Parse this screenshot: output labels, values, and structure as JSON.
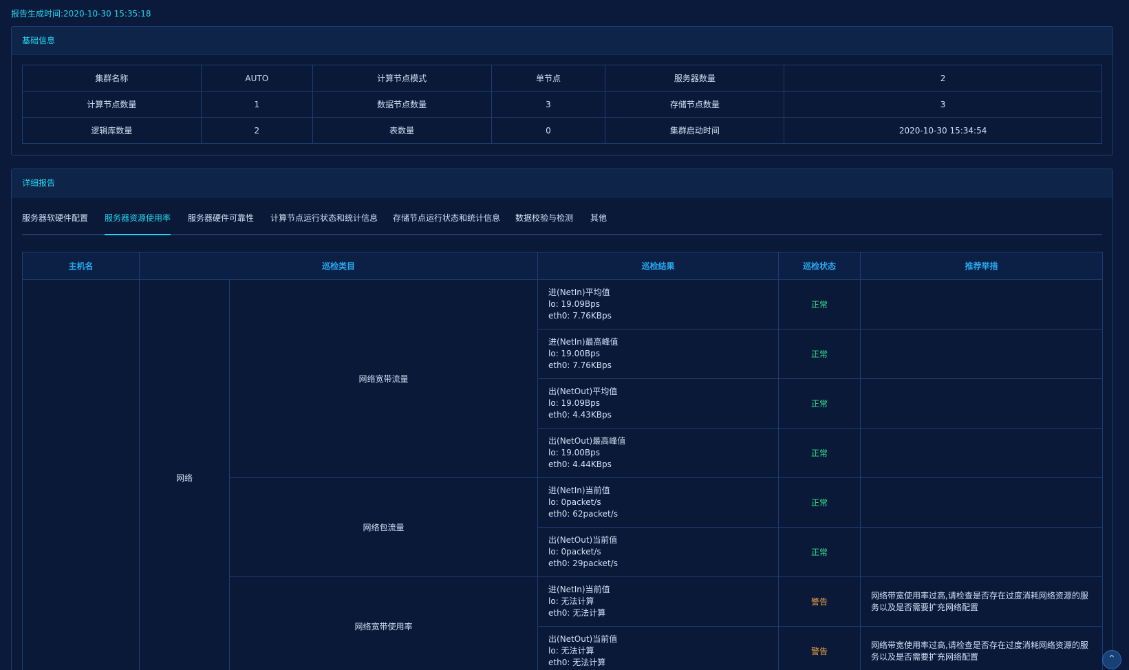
{
  "report": {
    "label": "报告生成时间:",
    "time": "2020-10-30 15:35:18"
  },
  "basic": {
    "title": "基础信息",
    "rows": [
      [
        "集群名称",
        "AUTO",
        "计算节点模式",
        "单节点",
        "服务器数量",
        "2"
      ],
      [
        "计算节点数量",
        "1",
        "数据节点数量",
        "3",
        "存储节点数量",
        "3"
      ],
      [
        "逻辑库数量",
        "2",
        "表数量",
        "0",
        "集群启动时间",
        "2020-10-30 15:34:54"
      ]
    ]
  },
  "detail": {
    "title": "详细报告",
    "tabs": [
      "服务器软硬件配置",
      "服务器资源使用率",
      "服务器硬件可靠性",
      "计算节点运行状态和统计信息",
      "存储节点运行状态和统计信息",
      "数据校验与检测",
      "其他"
    ],
    "active_tab": 1,
    "headers": [
      "主机名",
      "巡检类目",
      "巡检结果",
      "巡检状态",
      "推荐举措"
    ],
    "category": "网络",
    "groups": [
      {
        "name": "网络宽带流量"
      },
      {
        "name": "网络包流量"
      },
      {
        "name": "网络宽带使用率"
      }
    ],
    "rows": [
      {
        "result": [
          "进(NetIn)平均值",
          "lo: 19.09Bps",
          "eth0: 7.76KBps"
        ],
        "status": "正常",
        "advice": ""
      },
      {
        "result": [
          "进(NetIn)最高峰值",
          "lo: 19.00Bps",
          "eth0: 7.76KBps"
        ],
        "status": "正常",
        "advice": ""
      },
      {
        "result": [
          "出(NetOut)平均值",
          "lo: 19.09Bps",
          "eth0: 4.43KBps"
        ],
        "status": "正常",
        "advice": ""
      },
      {
        "result": [
          "出(NetOut)最高峰值",
          "lo: 19.00Bps",
          "eth0: 4.44KBps"
        ],
        "status": "正常",
        "advice": ""
      },
      {
        "result": [
          "进(NetIn)当前值",
          "lo: 0packet/s",
          "eth0: 62packet/s"
        ],
        "status": "正常",
        "advice": ""
      },
      {
        "result": [
          "出(NetOut)当前值",
          "lo: 0packet/s",
          "eth0: 29packet/s"
        ],
        "status": "正常",
        "advice": ""
      },
      {
        "result": [
          "进(NetIn)当前值",
          "lo: 无法计算",
          "eth0: 无法计算"
        ],
        "status": "警告",
        "advice": "网络带宽使用率过高,请检查是否存在过度消耗网络资源的服务以及是否需要扩充网络配置"
      },
      {
        "result": [
          "出(NetOut)当前值",
          "lo: 无法计算",
          "eth0: 无法计算"
        ],
        "status": "警告",
        "advice": "网络带宽使用率过高,请检查是否存在过度消耗网络资源的服务以及是否需要扩充网络配置"
      }
    ]
  },
  "scroll_top": {
    "icon": "chevron-up-icon",
    "glyph": "⌃"
  }
}
